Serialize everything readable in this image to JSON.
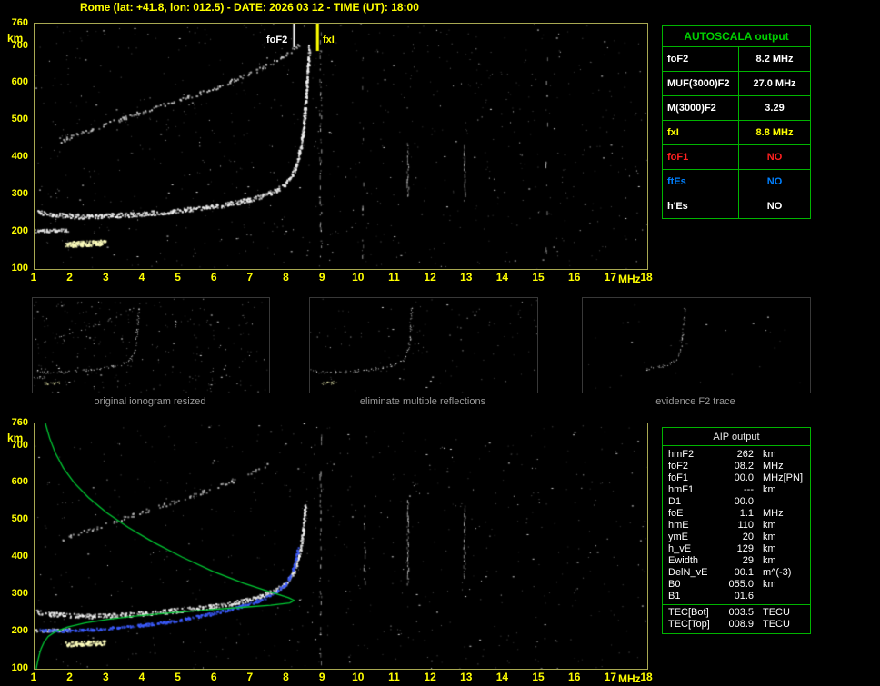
{
  "header": {
    "title": "Rome (lat: +41.8, lon: 012.5) - DATE: 2026 03 12 - TIME (UT): 18:00"
  },
  "autoscala": {
    "title": "AUTOSCALA output",
    "rows": [
      {
        "label": "foF2",
        "value": "8.2 MHz",
        "color": "#ffffff"
      },
      {
        "label": "MUF(3000)F2",
        "value": "27.0 MHz",
        "color": "#ffffff"
      },
      {
        "label": "M(3000)F2",
        "value": "3.29",
        "color": "#ffffff"
      },
      {
        "label": "fxI",
        "value": "8.8 MHz",
        "color": "#ffff00"
      },
      {
        "label": "foF1",
        "value": "NO",
        "color": "#ff2020"
      },
      {
        "label": "ftEs",
        "value": "NO",
        "color": "#0080ff"
      },
      {
        "label": "h'Es",
        "value": "NO",
        "color": "#ffffff"
      }
    ]
  },
  "aip": {
    "title": "AIP output",
    "rows": [
      {
        "label": "hmF2",
        "value": "262",
        "unit": "km",
        "note": ""
      },
      {
        "label": "foF2",
        "value": "08.2",
        "unit": "MHz",
        "note": ""
      },
      {
        "label": "foF1",
        "value": "00.0",
        "unit": "MHz",
        "note": "[PN]"
      },
      {
        "label": "hmF1",
        "value": "---",
        "unit": "km",
        "note": ""
      },
      {
        "label": "D1",
        "value": "00.0",
        "unit": "",
        "note": ""
      },
      {
        "label": "foE",
        "value": "1.1",
        "unit": "MHz",
        "note": ""
      },
      {
        "label": "hmE",
        "value": "110",
        "unit": "km",
        "note": ""
      },
      {
        "label": "ymE",
        "value": "20",
        "unit": "km",
        "note": ""
      },
      {
        "label": "h_vE",
        "value": "129",
        "unit": "km",
        "note": ""
      },
      {
        "label": "Ewidth",
        "value": "29",
        "unit": "km",
        "note": ""
      },
      {
        "label": "DelN_vE",
        "value": "00.1",
        "unit": "m^(-3)",
        "note": ""
      },
      {
        "label": "B0",
        "value": "055.0",
        "unit": "km",
        "note": ""
      },
      {
        "label": "B1",
        "value": "01.6",
        "unit": "",
        "note": ""
      }
    ],
    "tec_rows": [
      {
        "label": "TEC[Bot]",
        "value": "003.5",
        "unit": "TECU",
        "note": ""
      },
      {
        "label": "TEC[Top]",
        "value": "008.9",
        "unit": "TECU",
        "note": ""
      }
    ]
  },
  "thumbnails": [
    {
      "caption": "original ionogram resized",
      "render": {
        "series": [
          "F2-trace",
          "second-hop",
          "Es-strong",
          "Es-weak"
        ],
        "noise": 260
      }
    },
    {
      "caption": "eliminate multiple reflections",
      "render": {
        "series": [
          "F2-trace",
          "Es-strong"
        ],
        "noise": 110
      }
    },
    {
      "caption": "evidence F2 trace",
      "render": {
        "series": [
          "F2-trace"
        ],
        "noise": 30,
        "fmin": 5.8
      }
    }
  ],
  "colors": {
    "axis": "#ffff00",
    "table_grid": "#00b400",
    "fof1_status": "#ff2020",
    "ftes_status": "#0080ff",
    "fxi_value": "#ffff00",
    "profile_green": "#00cc33",
    "restored_blue": "#3c5cff"
  },
  "chart_data": [
    {
      "id": "ionogram-autoscaled",
      "type": "scatter",
      "title": "vertical incidence ionogram with AUTOSCALA markers",
      "xlabel": "MHz",
      "ylabel": "km",
      "xlim": [
        1,
        18
      ],
      "ylim": [
        100,
        760
      ],
      "x_ticks": [
        1,
        2,
        3,
        4,
        5,
        6,
        7,
        8,
        9,
        10,
        11,
        12,
        13,
        14,
        15,
        16,
        17,
        18
      ],
      "y_ticks": [
        760,
        700,
        600,
        500,
        400,
        300,
        200,
        100
      ],
      "grid": false,
      "markers": [
        {
          "label": "foF2",
          "freq": 8.2,
          "color": "#ffffff",
          "width": 2,
          "len": 26
        },
        {
          "label": "fxI",
          "freq": 8.85,
          "color": "#ffff00",
          "width": 3,
          "len": 30
        }
      ],
      "artifacts": [
        {
          "f": 8.93,
          "h1": 100,
          "h2": 750,
          "d": 0.1
        },
        {
          "f": 11.35,
          "h1": 300,
          "h2": 445,
          "d": 0.4
        },
        {
          "f": 12.92,
          "h1": 300,
          "h2": 440,
          "d": 0.35
        },
        {
          "f": 10.1,
          "h1": 130,
          "h2": 700,
          "d": 0.05
        },
        {
          "f": 15.2,
          "h1": 130,
          "h2": 700,
          "d": 0.04
        }
      ],
      "series": [
        {
          "name": "F2-trace",
          "color": "#f2f2f2",
          "thick": 5,
          "density": 1.5,
          "points": [
            [
              1.05,
              255
            ],
            [
              1.5,
              248
            ],
            [
              2.0,
              244
            ],
            [
              2.6,
              243
            ],
            [
              3.2,
              245
            ],
            [
              4.0,
              250
            ],
            [
              4.8,
              257
            ],
            [
              5.6,
              265
            ],
            [
              6.2,
              273
            ],
            [
              6.8,
              284
            ],
            [
              7.3,
              297
            ],
            [
              7.7,
              313
            ],
            [
              7.95,
              331
            ],
            [
              8.15,
              356
            ],
            [
              8.28,
              390
            ],
            [
              8.38,
              432
            ],
            [
              8.45,
              482
            ],
            [
              8.5,
              540
            ],
            [
              8.54,
              598
            ],
            [
              8.58,
              652
            ],
            [
              8.61,
              700
            ]
          ]
        },
        {
          "name": "second-hop",
          "color": "#cccccc",
          "thick": 4,
          "density": 0.5,
          "points": [
            [
              1.7,
              445
            ],
            [
              2.3,
              468
            ],
            [
              3.0,
              492
            ],
            [
              3.8,
              518
            ],
            [
              4.6,
              543
            ],
            [
              5.4,
              568
            ],
            [
              6.2,
              596
            ],
            [
              6.9,
              624
            ],
            [
              7.5,
              652
            ],
            [
              8.0,
              680
            ],
            [
              8.35,
              706
            ]
          ]
        },
        {
          "name": "Es-strong",
          "color": "#ffffbe",
          "thick": 6,
          "density": 3.5,
          "points": [
            [
              1.85,
              168
            ],
            [
              2.45,
              170
            ],
            [
              2.95,
              172
            ]
          ]
        },
        {
          "name": "Es-weak",
          "color": "#e6e6e6",
          "thick": 3,
          "density": 1.4,
          "points": [
            [
              1.0,
              204
            ],
            [
              1.5,
              205
            ],
            [
              1.95,
              206
            ]
          ]
        }
      ]
    },
    {
      "id": "ionogram-with-profile",
      "type": "scatter",
      "title": "ionogram with restored trace and electron density profile (AIP)",
      "xlabel": "MHz",
      "ylabel": "km",
      "xlim": [
        1,
        18
      ],
      "ylim": [
        100,
        760
      ],
      "x_ticks": [
        1,
        2,
        3,
        4,
        5,
        6,
        7,
        8,
        9,
        10,
        11,
        12,
        13,
        14,
        15,
        16,
        17,
        18
      ],
      "y_ticks": [
        760,
        700,
        600,
        500,
        400,
        300,
        200,
        100
      ],
      "grid": false,
      "markers": [],
      "artifacts": [
        {
          "f": 8.93,
          "h1": 100,
          "h2": 745,
          "d": 0.1
        },
        {
          "f": 11.35,
          "h1": 330,
          "h2": 560,
          "d": 0.32
        },
        {
          "f": 12.92,
          "h1": 350,
          "h2": 540,
          "d": 0.26
        },
        {
          "f": 10.15,
          "h1": 330,
          "h2": 560,
          "d": 0.12
        }
      ],
      "series": [
        {
          "name": "F2-trace",
          "color": "#f2f2f2",
          "thick": 5,
          "density": 1.3,
          "points": [
            [
              1.05,
              255
            ],
            [
              1.5,
              248
            ],
            [
              2.0,
              244
            ],
            [
              2.6,
              243
            ],
            [
              3.2,
              245
            ],
            [
              4.0,
              250
            ],
            [
              4.8,
              257
            ],
            [
              5.6,
              265
            ],
            [
              6.2,
              273
            ],
            [
              6.8,
              284
            ],
            [
              7.3,
              297
            ],
            [
              7.7,
              313
            ],
            [
              7.95,
              331
            ],
            [
              8.15,
              356
            ],
            [
              8.28,
              390
            ],
            [
              8.38,
              432
            ],
            [
              8.45,
              482
            ],
            [
              8.5,
              540
            ]
          ]
        },
        {
          "name": "second-hop",
          "color": "#bbbbbb",
          "thick": 4,
          "density": 0.35,
          "points": [
            [
              1.7,
              445
            ],
            [
              2.3,
              468
            ],
            [
              3.0,
              492
            ],
            [
              3.8,
              518
            ],
            [
              4.6,
              543
            ],
            [
              5.4,
              568
            ],
            [
              6.2,
              596
            ],
            [
              6.9,
              624
            ],
            [
              7.5,
              652
            ]
          ]
        },
        {
          "name": "Es-strong",
          "color": "#ffffbe",
          "thick": 5,
          "density": 2.5,
          "points": [
            [
              1.85,
              168
            ],
            [
              2.45,
              170
            ],
            [
              2.95,
              172
            ]
          ]
        },
        {
          "name": "Es-weak",
          "color": "#e6e6e6",
          "thick": 3,
          "density": 1.4,
          "points": [
            [
              1.0,
              204
            ],
            [
              1.5,
              205
            ],
            [
              1.95,
              206
            ]
          ]
        },
        {
          "name": "restored-trace",
          "color": "#3c5cff",
          "thick": 3,
          "density": 1.3,
          "points": [
            [
              1.1,
              205
            ],
            [
              1.8,
              204
            ],
            [
              2.6,
              207
            ],
            [
              3.4,
              213
            ],
            [
              4.2,
              221
            ],
            [
              5.0,
              232
            ],
            [
              5.8,
              247
            ],
            [
              6.5,
              263
            ],
            [
              7.1,
              281
            ],
            [
              7.6,
              302
            ],
            [
              7.9,
              325
            ],
            [
              8.1,
              352
            ],
            [
              8.22,
              388
            ],
            [
              8.3,
              424
            ]
          ]
        },
        {
          "name": "N(h)-profile",
          "color": "#00cc33",
          "style": "line",
          "points": [
            [
              1.3,
              760
            ],
            [
              1.42,
              720
            ],
            [
              1.58,
              680
            ],
            [
              1.8,
              640
            ],
            [
              2.1,
              600
            ],
            [
              2.5,
              560
            ],
            [
              3.0,
              520
            ],
            [
              3.6,
              480
            ],
            [
              4.3,
              440
            ],
            [
              5.1,
              400
            ],
            [
              5.95,
              362
            ],
            [
              6.8,
              330
            ],
            [
              7.55,
              306
            ],
            [
              8.05,
              291
            ],
            [
              8.2,
              284
            ],
            [
              8.08,
              277
            ],
            [
              7.55,
              271
            ],
            [
              6.75,
              265
            ],
            [
              5.75,
              258
            ],
            [
              4.75,
              250
            ],
            [
              3.85,
              242
            ],
            [
              3.05,
              233
            ],
            [
              2.4,
              223
            ],
            [
              1.92,
              212
            ],
            [
              1.58,
              200
            ],
            [
              1.38,
              187
            ],
            [
              1.26,
              171
            ],
            [
              1.18,
              154
            ],
            [
              1.13,
              137
            ],
            [
              1.09,
              121
            ],
            [
              1.06,
              107
            ],
            [
              1.05,
              100
            ]
          ]
        }
      ]
    }
  ]
}
